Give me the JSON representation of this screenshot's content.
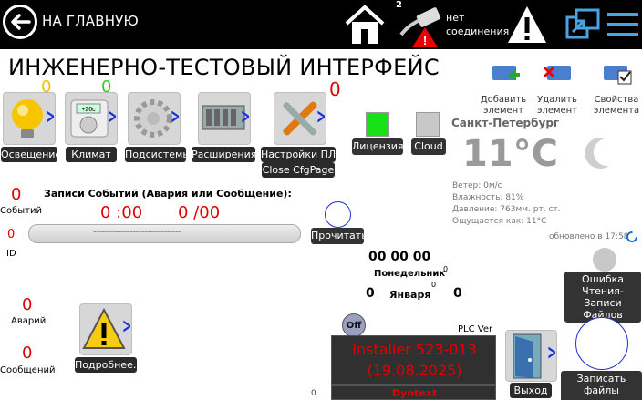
{
  "header": {
    "back_title": "НА ГЛАВНУЮ",
    "network_count": "2",
    "network_status_line1": "нет",
    "network_status_line2": "соединения"
  },
  "title": "ИНЖЕНЕРНО-ТЕСТОВЫЙ ИНТЕРФЕЙС",
  "tiles": [
    {
      "label": "Освещение",
      "icon": "light-bulb-icon",
      "count": "0"
    },
    {
      "label": "Климат",
      "icon": "thermostat-icon",
      "count": "0"
    },
    {
      "label": "Подсистемы",
      "icon": "gear-icon"
    },
    {
      "label": "Расширения",
      "icon": "modules-icon"
    },
    {
      "label": "Настройки ПЛК",
      "icon": "tools-icon",
      "count": "0",
      "sub_label": "Close CfgPage"
    }
  ],
  "element_actions": {
    "add": "Добавить элемент",
    "delete": "Удалить элемент",
    "properties": "Свойства элемента"
  },
  "license_label": "Лицензия",
  "cloud_label": "Cloud",
  "weather": {
    "city": "Санкт-Петербург",
    "temperature": "11°C",
    "wind": "Ветер: 0м/с",
    "humidity": "Влажность: 81%",
    "pressure": "Давление: 763мм. рт. ст.",
    "feels_like": "Ощущается как: 11°C",
    "updated": "обновлено в 17:58"
  },
  "events": {
    "count": "0",
    "count_label": "Событий",
    "heading": "Записи Событий (Авария или Сообщение):",
    "time": "0 :00",
    "ratio": "0 /00",
    "dashes": "-------------------------------",
    "id_value": "0",
    "id_label": "ID",
    "read_button": "Прочитать"
  },
  "clock": {
    "time": "00 00 00",
    "day_index": "0",
    "weekday": "Понедельник",
    "day": "0",
    "month": "Января",
    "month_index": "0",
    "year": "0",
    "plc_ver_label": "PLC Ver"
  },
  "alarms": {
    "count": "0",
    "label": "Аварий"
  },
  "messages": {
    "count": "0",
    "label": "Сообщений"
  },
  "details_button": "Подробнее..",
  "off_label": "Off",
  "installer": {
    "line1": "Installer  523-013",
    "line2": "(19.08.2025)",
    "line3": "Dyntext"
  },
  "bottom_small_zero": "0",
  "exit_label": "Выход",
  "file_error": {
    "line1": "Ошибка",
    "line2": "Чтения-Записи",
    "line3": "Файлов"
  },
  "save_settings": {
    "line1": "Записать",
    "line2": "файлы настроек"
  }
}
